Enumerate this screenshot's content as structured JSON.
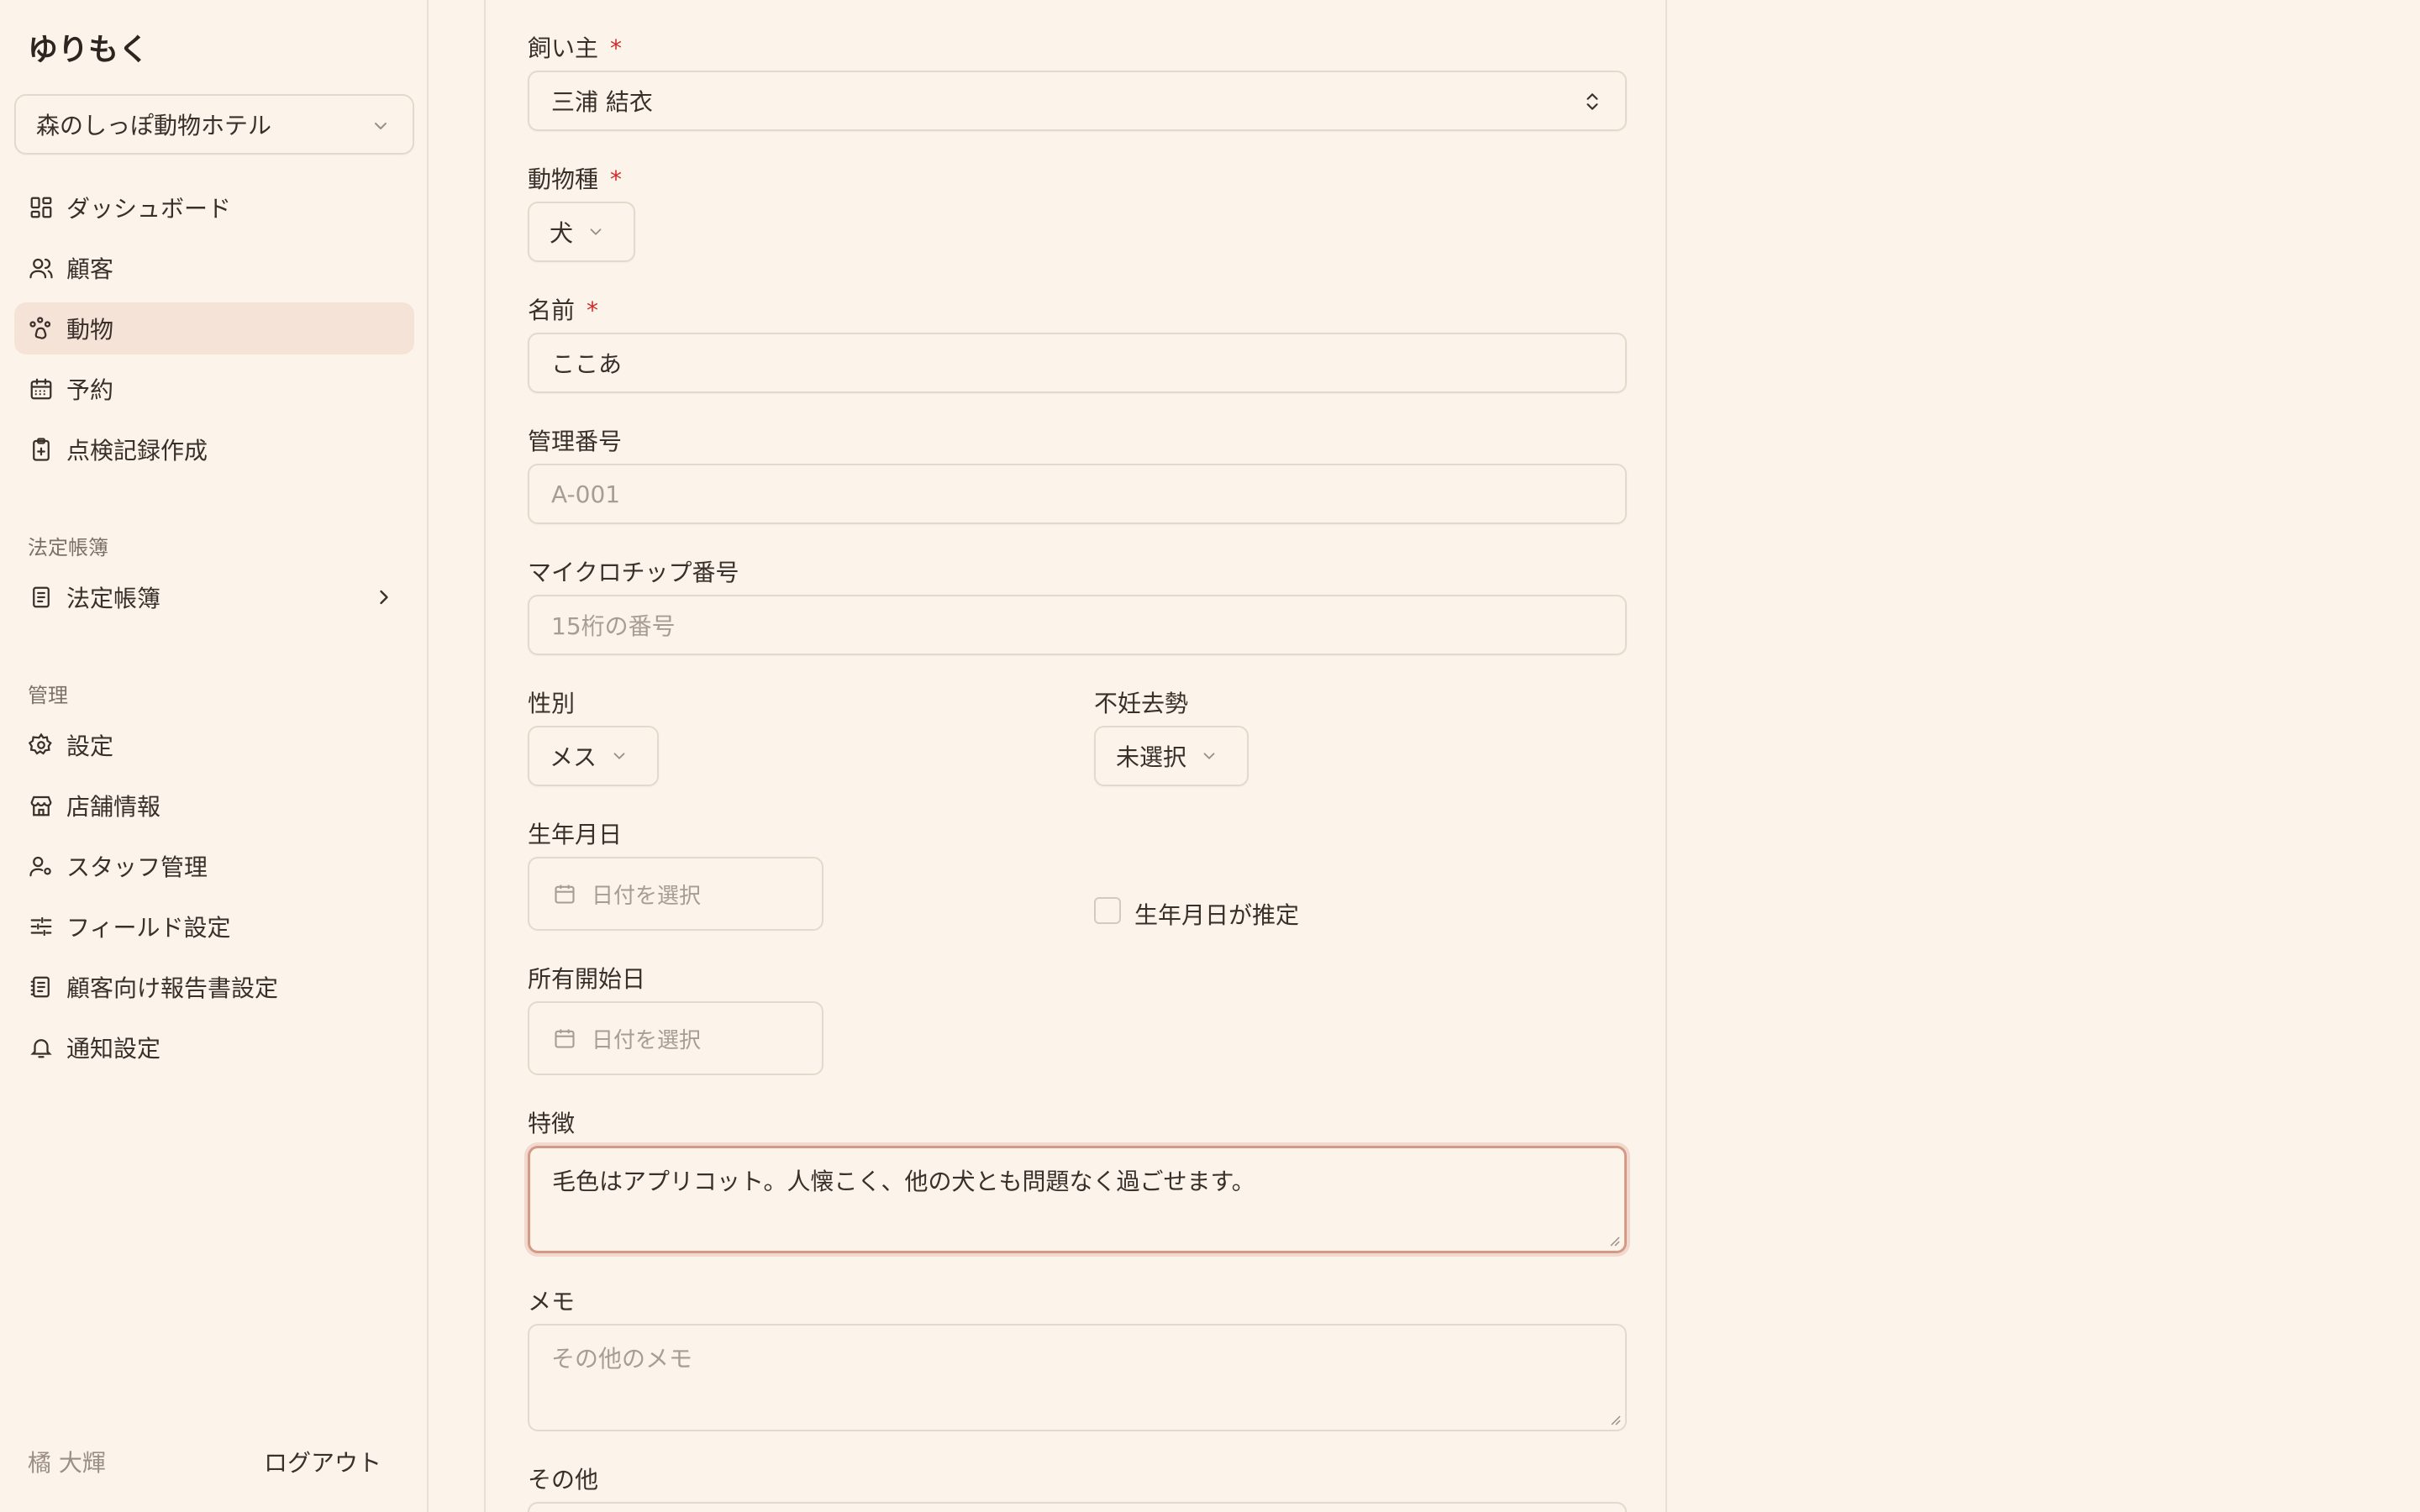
{
  "app": {
    "brand": "ゆりもく"
  },
  "sidebar": {
    "store": "森のしっぽ動物ホテル",
    "nav": [
      {
        "label": "ダッシュボード",
        "icon": "dashboard-icon"
      },
      {
        "label": "顧客",
        "icon": "users-icon"
      },
      {
        "label": "動物",
        "icon": "paw-icon",
        "active": true
      },
      {
        "label": "予約",
        "icon": "calendar-icon"
      },
      {
        "label": "点検記録作成",
        "icon": "clipboard-plus-icon"
      }
    ],
    "section_legal": "法定帳簿",
    "legal_item": "法定帳簿",
    "section_admin": "管理",
    "admin": [
      {
        "label": "設定",
        "icon": "gear-icon"
      },
      {
        "label": "店舗情報",
        "icon": "store-icon"
      },
      {
        "label": "スタッフ管理",
        "icon": "user-cog-icon"
      },
      {
        "label": "フィールド設定",
        "icon": "sliders-icon"
      },
      {
        "label": "顧客向け報告書設定",
        "icon": "report-icon"
      },
      {
        "label": "通知設定",
        "icon": "bell-icon"
      }
    ],
    "user_name": "橘 大輝",
    "logout": "ログアウト"
  },
  "form": {
    "owner_label": "飼い主",
    "owner_value": "三浦 結衣",
    "species_label": "動物種",
    "species_value": "犬",
    "name_label": "名前",
    "name_value": "ここあ",
    "mgmt_label": "管理番号",
    "mgmt_placeholder": "A-001",
    "chip_label": "マイクロチップ番号",
    "chip_placeholder": "15桁の番号",
    "sex_label": "性別",
    "sex_value": "メス",
    "neuter_label": "不妊去勢",
    "neuter_value": "未選択",
    "birth_label": "生年月日",
    "birth_placeholder": "日付を選択",
    "birth_estimated_label": "生年月日が推定",
    "owned_label": "所有開始日",
    "owned_placeholder": "日付を選択",
    "features_label": "特徴",
    "features_value": "毛色はアプリコット。人懐こく、他の犬とも問題なく過ごせます。",
    "memo_label": "メモ",
    "memo_placeholder": "その他のメモ",
    "other_label": "その他",
    "required_mark": "*"
  }
}
